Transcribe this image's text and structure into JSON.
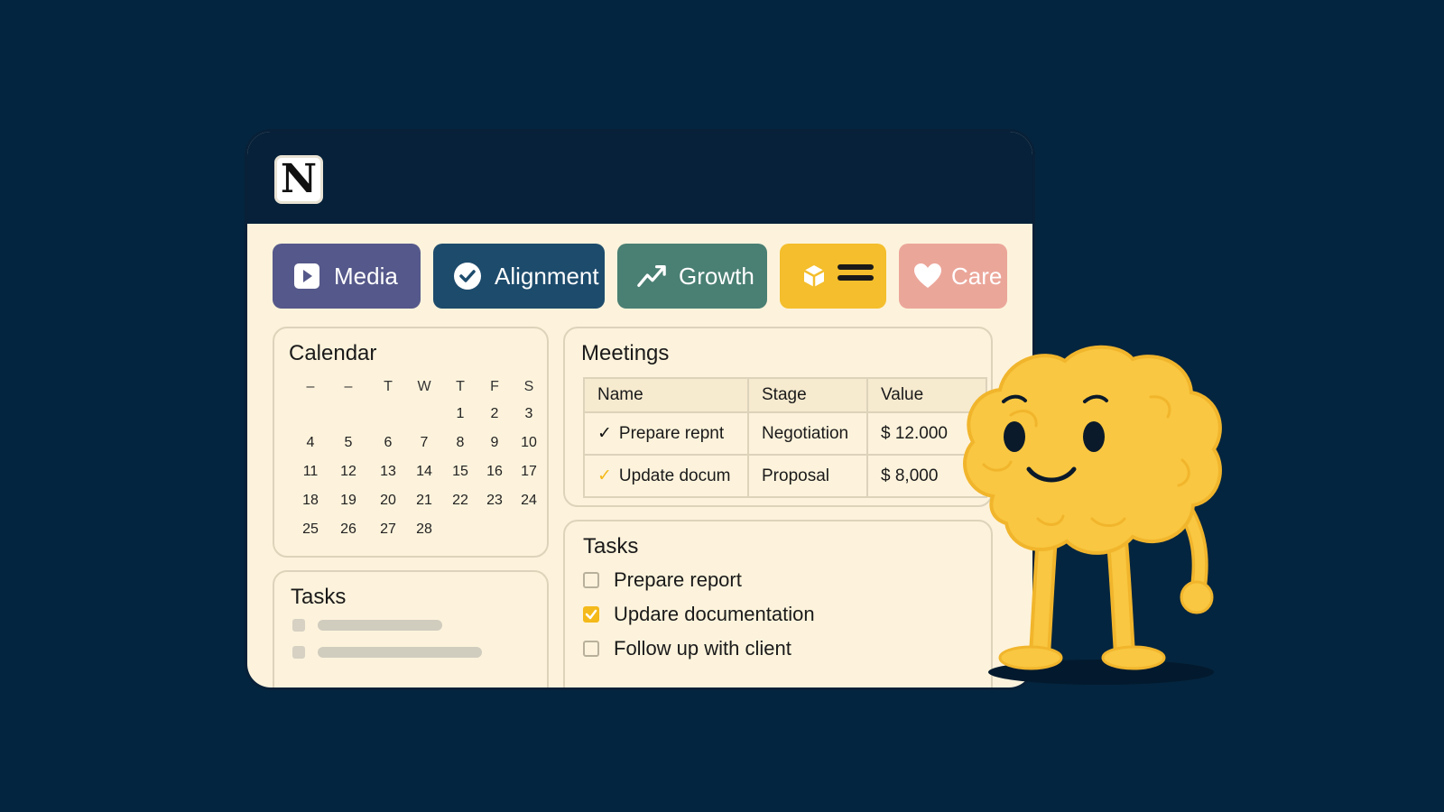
{
  "app": {
    "logo_letter": "N"
  },
  "tabs": [
    {
      "label": "Media",
      "color": "#55588a",
      "icon": "play-icon"
    },
    {
      "label": "Alignment",
      "color": "#1d4b6c",
      "icon": "check-circle-icon"
    },
    {
      "label": "Growth",
      "color": "#4a7f73",
      "icon": "trend-up-icon"
    },
    {
      "label": "",
      "color": "#f4be2c",
      "icon": "cube-menu-icon"
    },
    {
      "label": "Care",
      "color": "#eba69a",
      "icon": "heart-icon"
    }
  ],
  "calendar": {
    "title": "Calendar",
    "weekdays": [
      "–",
      "–",
      "T",
      "W",
      "T",
      "F",
      "S"
    ],
    "weeks": [
      [
        "",
        "",
        "",
        "",
        "1",
        "2",
        "3"
      ],
      [
        "4",
        "5",
        "6",
        "7",
        "8",
        "9",
        "10"
      ],
      [
        "11",
        "12",
        "13",
        "14",
        "15",
        "16",
        "17"
      ],
      [
        "18",
        "19",
        "20",
        "21",
        "22",
        "23",
        "24"
      ],
      [
        "25",
        "26",
        "27",
        "28",
        "",
        "",
        ""
      ]
    ]
  },
  "meetings": {
    "title": "Meetings",
    "columns": [
      "Name",
      "Stage",
      "Value"
    ],
    "rows": [
      {
        "check": "✓",
        "check_color": "#111111",
        "name": "Prepare repnt",
        "stage": "Negotiation",
        "value": "$ 12.000"
      },
      {
        "check": "✓",
        "check_color": "#f4b91a",
        "name": "Update docum",
        "stage": "Proposal",
        "value": "$ 8,000"
      }
    ]
  },
  "tasks_left": {
    "title": "Tasks"
  },
  "tasks_right": {
    "title": "Tasks",
    "items": [
      {
        "label": "Prepare report",
        "checked": false
      },
      {
        "label": "Updare documentation",
        "checked": true
      },
      {
        "label": "Follow up with client",
        "checked": false
      }
    ]
  },
  "colors": {
    "background": "#04253f",
    "window": "#fdf3dc",
    "titlebar": "#062139",
    "mascot": "#f9c741"
  }
}
